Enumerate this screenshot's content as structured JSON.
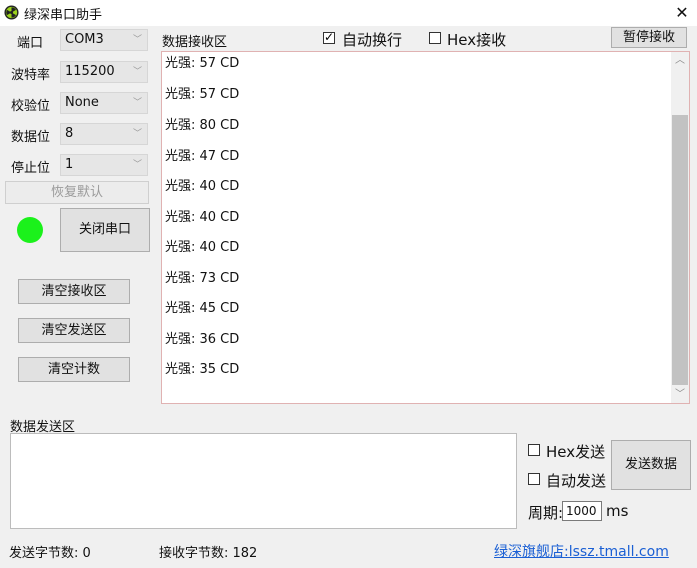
{
  "window": {
    "title": "绿深串口助手",
    "close_glyph": "✕",
    "app_icon": "app-logo-icon"
  },
  "settings": {
    "port": {
      "label": "端口",
      "value": "COM3"
    },
    "baud": {
      "label": "波特率",
      "value": "115200"
    },
    "parity": {
      "label": "校验位",
      "value": "None"
    },
    "data_bits": {
      "label": "数据位",
      "value": "8"
    },
    "stop_bits": {
      "label": "停止位",
      "value": "1"
    },
    "restore_label": "恢复默认",
    "close_port_label": "关闭串口",
    "led_color": "#1bf11b"
  },
  "actions": {
    "clear_recv": "清空接收区",
    "clear_send": "清空发送区",
    "clear_count": "清空计数"
  },
  "receive": {
    "label": "数据接收区",
    "auto_newline_label": "自动换行",
    "auto_newline_checked": true,
    "hex_recv_label": "Hex接收",
    "hex_recv_checked": false,
    "pause_label": "暂停接收",
    "lines": [
      "光强: 57 CD",
      "光强: 57 CD",
      "光强: 80 CD",
      "光强: 47 CD",
      "光强: 40 CD",
      "光强: 40 CD",
      "光强: 40 CD",
      "光强: 73 CD",
      "光强: 45 CD",
      "光强: 36 CD",
      "光强: 35 CD"
    ]
  },
  "send": {
    "label": "数据发送区",
    "hex_send_label": "Hex发送",
    "auto_send_label": "自动发送",
    "period_label": "周期:",
    "period_value": "1000",
    "period_unit": "ms",
    "send_button_label": "发送数据"
  },
  "status": {
    "sent_bytes": "发送字节数: 0",
    "recv_bytes": "接收字节数: 182",
    "link": "绿深旗舰店:lssz.tmall.com"
  }
}
